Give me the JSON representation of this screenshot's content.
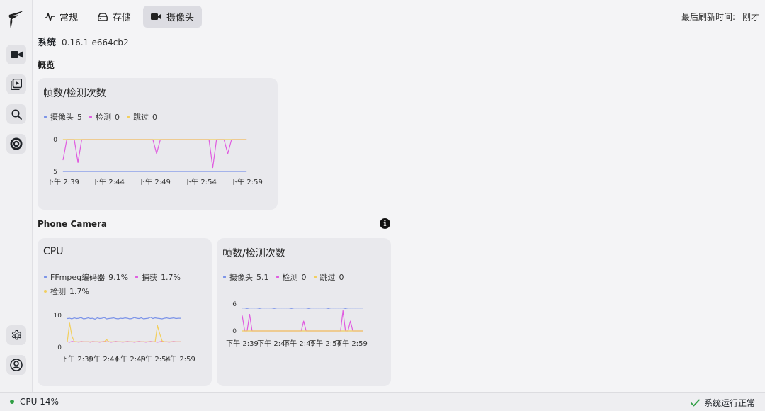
{
  "nav": {
    "tabs": [
      {
        "label": "常规",
        "icon": "activity-icon",
        "active": false
      },
      {
        "label": "存储",
        "icon": "hard-drive-icon",
        "active": false
      },
      {
        "label": "摄像头",
        "icon": "camera-icon",
        "active": true
      }
    ],
    "refresh_label": "最后刷新时间:",
    "refresh_value": "刚才"
  },
  "sidebar": {
    "items": [
      {
        "icon": "video-camera-icon"
      },
      {
        "icon": "media-library-icon"
      },
      {
        "icon": "search-icon"
      },
      {
        "icon": "frigate-plus-icon"
      },
      {
        "icon": "settings-gear-icon"
      },
      {
        "icon": "user-account-icon"
      }
    ]
  },
  "system": {
    "label": "系统",
    "version": "0.16.1-e664cb2"
  },
  "overview": {
    "section_title": "概览"
  },
  "camera_section": {
    "title": "Phone Camera"
  },
  "status": {
    "cpu": "CPU 14%",
    "health": "系统运行正常"
  },
  "colors": {
    "camera": "#7b93e8",
    "detect": "#e05ce0",
    "skip": "#f2cf5e",
    "ok": "#2f9e44"
  },
  "chart_data": [
    {
      "type": "line",
      "title": "帧数/检测次数",
      "legend": [
        {
          "name": "摄像头",
          "value": "5"
        },
        {
          "name": "检测",
          "value": "0"
        },
        {
          "name": "跳过",
          "value": "0"
        }
      ],
      "x_ticks": [
        "下午 2:39",
        "下午 2:44",
        "下午 2:49",
        "下午 2:54",
        "下午 2:59"
      ],
      "y_ticks": [
        "0",
        "5"
      ],
      "ylim": [
        0,
        5
      ],
      "series": [
        {
          "name": "摄像头",
          "color": "#7b93e8",
          "values": [
            5,
            5,
            5,
            5,
            5,
            5,
            5,
            5,
            5,
            5,
            5,
            5,
            5,
            5,
            5,
            5,
            5,
            5,
            5,
            5,
            5,
            5,
            5,
            5,
            5,
            5,
            5,
            5,
            5,
            5,
            5,
            5,
            5,
            5,
            5,
            5,
            5,
            5,
            5,
            5,
            5,
            5,
            5,
            5,
            5,
            5,
            5,
            5,
            5,
            5
          ]
        },
        {
          "name": "检测",
          "color": "#e05ce0",
          "values": [
            3.2,
            0,
            0,
            0,
            3.6,
            0,
            0,
            0,
            0,
            0,
            0,
            0,
            0,
            0,
            0,
            0,
            0,
            0,
            0,
            0,
            0,
            0,
            0,
            0,
            0,
            2.2,
            0,
            0,
            0,
            0,
            0,
            0,
            0,
            0,
            0,
            0,
            0,
            0,
            0,
            0,
            4.4,
            0,
            0,
            0,
            2.2,
            0,
            0,
            0,
            0,
            0
          ]
        },
        {
          "name": "跳过",
          "color": "#f2cf5e",
          "values": [
            0,
            0,
            0,
            0,
            0,
            0,
            0,
            0,
            0,
            0,
            0,
            0,
            0,
            0,
            0,
            0,
            0,
            0,
            0,
            0,
            0,
            0,
            0,
            0,
            0,
            0,
            0,
            0,
            0,
            0,
            0,
            0,
            0,
            0,
            0,
            0,
            0,
            0,
            0,
            0,
            0,
            0,
            0,
            0,
            0,
            0,
            0,
            0,
            0,
            0
          ]
        }
      ]
    },
    {
      "type": "line",
      "title": "CPU",
      "legend": [
        {
          "name": "FFmpeg编码器",
          "value": "9.1%"
        },
        {
          "name": "捕获",
          "value": "1.7%"
        },
        {
          "name": "检测",
          "value": "1.7%"
        }
      ],
      "x_ticks": [
        "下午 2:39",
        "下午 2:44",
        "下午 2:49",
        "下午 2:54",
        "下午 2:59"
      ],
      "y_ticks": [
        "0",
        "10"
      ],
      "ylim": [
        0,
        10
      ],
      "series": [
        {
          "name": "FFmpeg编码器",
          "color": "#7b93e8",
          "values": [
            9,
            9.1,
            8.9,
            9.2,
            9,
            9.1,
            9.3,
            8.9,
            9,
            9.2,
            9,
            9.1,
            8.8,
            9.2,
            9,
            9.1,
            9.3,
            8.9,
            9,
            9.1,
            9.2,
            9,
            8.9,
            9.1,
            9,
            9.2,
            9.1,
            8.9,
            9,
            9.3,
            9.1,
            9,
            9.2,
            8.9,
            9,
            9.1,
            9.4,
            9,
            9.2,
            9.1,
            9,
            8.9,
            9.1,
            9.2,
            9,
            9.1,
            9.2,
            9,
            9.1,
            9.1
          ]
        },
        {
          "name": "捕获",
          "color": "#e05ce0",
          "values": [
            1.7,
            1.6,
            1.8,
            1.7,
            1.7,
            1.6,
            1.8,
            1.7,
            1.7,
            1.7,
            1.6,
            1.8,
            1.7,
            1.7,
            1.6,
            1.7,
            1.8,
            1.7,
            1.7,
            1.6,
            1.7,
            1.8,
            1.7,
            1.7,
            1.6,
            1.7,
            1.8,
            1.7,
            1.7,
            1.6,
            1.7,
            1.8,
            1.7,
            1.7,
            1.6,
            1.7,
            1.8,
            1.7,
            1.7,
            1.6,
            1.7,
            1.8,
            1.7,
            1.7,
            1.6,
            1.7,
            1.8,
            1.7,
            1.7,
            1.7
          ]
        },
        {
          "name": "检测",
          "color": "#f2cf5e",
          "values": [
            1.7,
            7.6,
            3.5,
            1.8,
            1.7,
            1.7,
            1.7,
            1.7,
            1.7,
            1.7,
            1.7,
            1.7,
            1.7,
            1.7,
            1.7,
            1.7,
            1.7,
            2.4,
            1.7,
            1.7,
            1.7,
            1.7,
            1.7,
            1.7,
            1.7,
            1.7,
            1.7,
            1.7,
            1.7,
            1.7,
            1.7,
            1.7,
            1.7,
            1.7,
            1.7,
            1.7,
            1.7,
            1.7,
            1.7,
            6.8,
            4.2,
            2,
            1.7,
            1.7,
            1.7,
            1.7,
            1.7,
            1.7,
            1.7,
            1.7
          ]
        }
      ]
    },
    {
      "type": "line",
      "title": "帧数/检测次数",
      "legend": [
        {
          "name": "摄像头",
          "value": "5.1"
        },
        {
          "name": "检测",
          "value": "0"
        },
        {
          "name": "跳过",
          "value": "0"
        }
      ],
      "x_ticks": [
        "下午 2:39",
        "下午 2:44",
        "下午 2:49",
        "下午 2:54",
        "下午 2:59"
      ],
      "y_ticks": [
        "0",
        "6"
      ],
      "ylim": [
        0,
        6
      ],
      "series": [
        {
          "name": "摄像头",
          "color": "#7b93e8",
          "values": [
            5.1,
            5.1,
            5.0,
            5.1,
            5.1,
            5.1,
            5.1,
            5.0,
            5.1,
            5.1,
            5.1,
            5.1,
            5.1,
            5.0,
            5.1,
            5.1,
            5.1,
            5.1,
            5.1,
            5.1,
            5.0,
            5.1,
            5.1,
            5.1,
            5.1,
            5.1,
            5.1,
            5.0,
            5.1,
            5.1,
            5.1,
            5.1,
            5.1,
            5.1,
            5.1,
            5.0,
            5.1,
            5.1,
            5.1,
            5.1,
            5.1,
            5.1,
            5.0,
            5.1,
            5.1,
            5.1,
            5.1,
            5.1,
            5.1,
            5.1
          ]
        },
        {
          "name": "检测",
          "color": "#e05ce0",
          "values": [
            3.4,
            0,
            0,
            3.7,
            0,
            0,
            0,
            0,
            0,
            0,
            0,
            0,
            0,
            0,
            0,
            0,
            0,
            0,
            0,
            0,
            0,
            0,
            0,
            0,
            0,
            2.2,
            0,
            0,
            0,
            0,
            0,
            0,
            0,
            0,
            0,
            0,
            0,
            0,
            0,
            0,
            0,
            4.5,
            0,
            0,
            2.2,
            0,
            0,
            0,
            0,
            0
          ]
        },
        {
          "name": "跳过",
          "color": "#f2cf5e",
          "values": [
            0,
            0,
            0,
            0,
            0,
            0,
            0,
            0,
            0,
            0,
            0,
            0,
            0,
            0,
            0,
            0,
            0,
            0,
            0,
            0,
            0,
            0,
            0,
            0,
            0,
            0,
            0,
            0,
            0,
            0,
            0,
            0,
            0,
            0,
            0,
            0,
            0,
            0,
            0,
            0,
            0,
            0,
            0,
            0,
            0,
            0,
            0,
            0,
            0,
            0
          ]
        }
      ]
    }
  ]
}
